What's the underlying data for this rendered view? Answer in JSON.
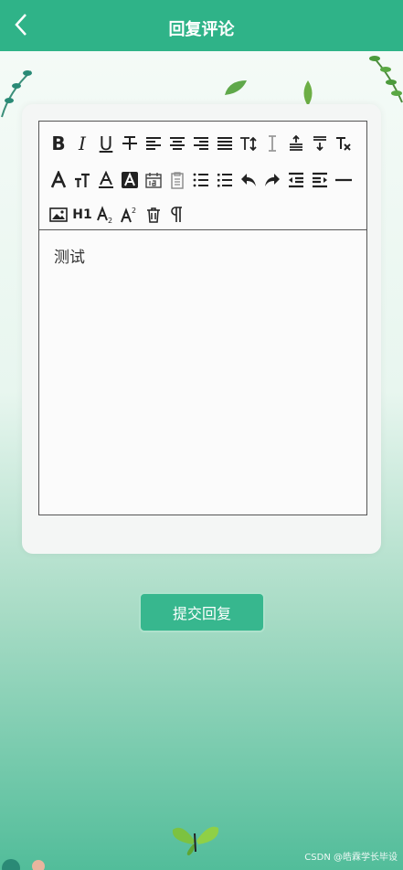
{
  "header": {
    "title": "回复评论"
  },
  "editor": {
    "content": "测试",
    "toolbar": [
      [
        "bold",
        "italic",
        "underline",
        "strikethrough",
        "align-left",
        "align-center",
        "align-right",
        "align-justify",
        "font-size",
        "line-height",
        "paragraph-top",
        "paragraph-bottom",
        "clear-format"
      ],
      [
        "font-family",
        "text-size",
        "font-color",
        "background-color",
        "date",
        "time",
        "ordered-list",
        "unordered-list",
        "undo",
        "redo",
        "outdent",
        "indent",
        "horizontal-rule"
      ],
      [
        "image",
        "heading",
        "subscript",
        "superscript",
        "delete",
        "paragraph-mark"
      ]
    ],
    "labels": {
      "bold": "B",
      "italic": "I",
      "underline": "U",
      "heading": "H1"
    }
  },
  "submit": {
    "label": "提交回复"
  },
  "watermark": "CSDN @皓霖学长毕设",
  "colors": {
    "primary": "#2fb388",
    "button": "#37b78e"
  }
}
